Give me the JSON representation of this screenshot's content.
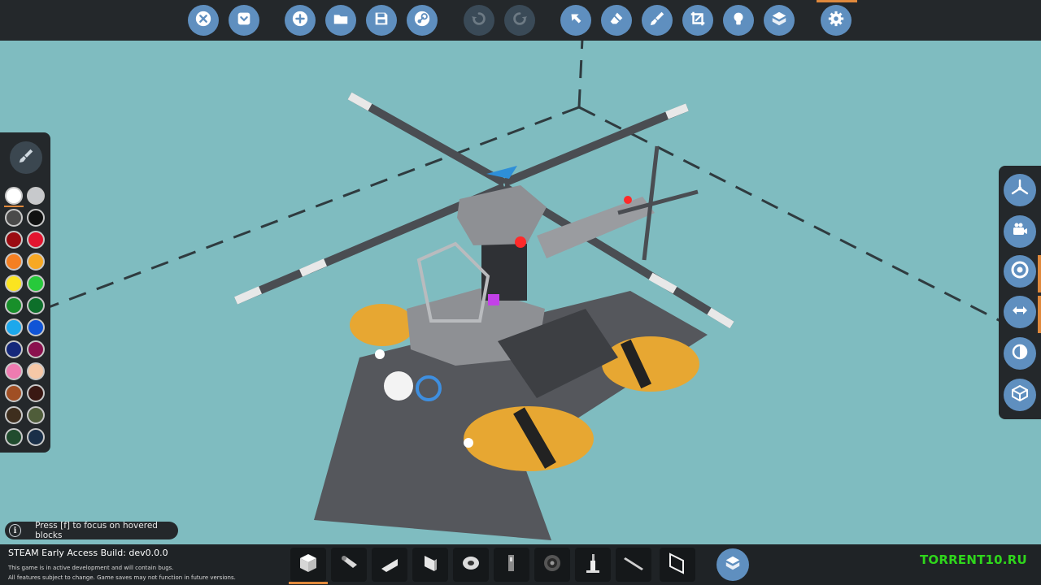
{
  "toolbar": {
    "buttons": [
      {
        "icon": "close-icon",
        "enabled": true
      },
      {
        "icon": "shirt-icon",
        "enabled": true
      },
      {
        "icon": "new-icon",
        "enabled": true
      },
      {
        "icon": "folder-icon",
        "enabled": true
      },
      {
        "icon": "save-icon",
        "enabled": true
      },
      {
        "icon": "steam-icon",
        "enabled": true
      },
      {
        "icon": "undo-icon",
        "enabled": false
      },
      {
        "icon": "redo-icon",
        "enabled": false
      },
      {
        "icon": "select-arrow-icon",
        "enabled": true
      },
      {
        "icon": "eraser-icon",
        "enabled": true
      },
      {
        "icon": "paint-icon",
        "enabled": true
      },
      {
        "icon": "crop-icon",
        "enabled": true
      },
      {
        "icon": "lightbulb-icon",
        "enabled": true
      },
      {
        "icon": "cubes-icon",
        "enabled": true
      },
      {
        "icon": "gear-icon",
        "enabled": true
      }
    ]
  },
  "palette": {
    "tool_icon": "paint-brush-icon",
    "colors": [
      [
        "#ffffff",
        "#c7c9cc"
      ],
      [
        "#4a4a4a",
        "#111111"
      ],
      [
        "#9b0c12",
        "#e3152f"
      ],
      [
        "#f47f22",
        "#f7a823"
      ],
      [
        "#fbe420",
        "#27c93b"
      ],
      [
        "#188f2a",
        "#0d6f2a"
      ],
      [
        "#1ca8ec",
        "#1054d6"
      ],
      [
        "#15287b",
        "#8a114e"
      ],
      [
        "#ee7bb0",
        "#f6c8a7"
      ],
      [
        "#a04f24",
        "#3a1813"
      ],
      [
        "#3e2e1e",
        "#4f5d3a"
      ],
      [
        "#214c2e",
        "#1a2f48"
      ]
    ],
    "selected_color": "#ffffff"
  },
  "right_panel": {
    "buttons": [
      {
        "icon": "propeller-icon"
      },
      {
        "icon": "camera-icon"
      },
      {
        "icon": "target-icon"
      },
      {
        "icon": "transfer-arrows-icon"
      },
      {
        "icon": "half-circle-icon"
      },
      {
        "icon": "box-icon"
      }
    ]
  },
  "hint": {
    "icon": "i",
    "text": "Press [f] to focus on hovered blocks"
  },
  "build_info": {
    "title": "STEAM Early Access Build: dev0.0.0",
    "line1": "This game is in active development and will contain bugs.",
    "line2": "All features subject to change. Game saves may not function in future versions."
  },
  "hotbar": {
    "slots": [
      {
        "icon": "block-icon"
      },
      {
        "icon": "pipe-icon"
      },
      {
        "icon": "wedge-icon"
      },
      {
        "icon": "panel-icon"
      },
      {
        "icon": "wheel-icon"
      },
      {
        "icon": "seat-icon"
      },
      {
        "icon": "tire-icon"
      },
      {
        "icon": "robot-arm-icon"
      },
      {
        "icon": "rod-icon"
      },
      {
        "icon": "glass-icon"
      }
    ],
    "inventory_icon": "cubes-icon"
  },
  "watermark": "TORRENT10.RU",
  "colors": {
    "sky": "#7fbcc0",
    "ui_bg": "#24282b",
    "button": "#5f8fbf",
    "accent": "#e0893c"
  }
}
